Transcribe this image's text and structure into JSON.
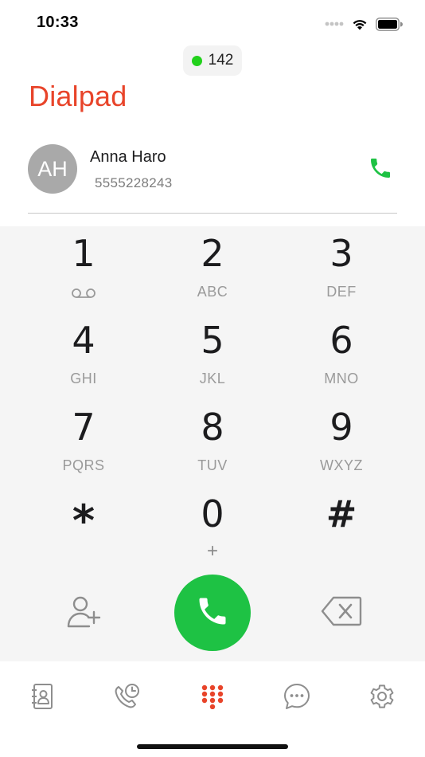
{
  "status_bar": {
    "time": "10:33",
    "icons": [
      "signal-dots-icon",
      "wifi-icon",
      "battery-icon"
    ]
  },
  "extension": {
    "number": "142",
    "status_color": "#22d11c"
  },
  "page": {
    "title": "Dialpad",
    "title_color": "#e8442a"
  },
  "contact": {
    "initials": "AH",
    "name": "Anna Haro",
    "number": "5555228243",
    "call_icon": "phone-icon"
  },
  "keypad": {
    "keys": [
      {
        "digit": "1",
        "letters": "",
        "sub_icon": "voicemail-icon"
      },
      {
        "digit": "2",
        "letters": "ABC"
      },
      {
        "digit": "3",
        "letters": "DEF"
      },
      {
        "digit": "4",
        "letters": "GHI"
      },
      {
        "digit": "5",
        "letters": "JKL"
      },
      {
        "digit": "6",
        "letters": "MNO"
      },
      {
        "digit": "7",
        "letters": "PQRS"
      },
      {
        "digit": "8",
        "letters": "TUV"
      },
      {
        "digit": "9",
        "letters": "WXYZ"
      },
      {
        "digit": "*",
        "letters": ""
      },
      {
        "digit": "0",
        "letters": "+"
      },
      {
        "digit": "#",
        "letters": ""
      }
    ]
  },
  "actions": {
    "add_contact_icon": "add-contact-icon",
    "call_icon": "phone-icon",
    "call_color": "#1ec244",
    "backspace_icon": "backspace-icon"
  },
  "tab_bar": {
    "tabs": [
      {
        "icon": "contacts-icon",
        "active": false
      },
      {
        "icon": "recent-calls-icon",
        "active": false
      },
      {
        "icon": "dialpad-icon",
        "active": true
      },
      {
        "icon": "chat-icon",
        "active": false
      },
      {
        "icon": "settings-icon",
        "active": false
      }
    ],
    "active_color": "#e8442a",
    "inactive_color": "#8e8e8e"
  }
}
